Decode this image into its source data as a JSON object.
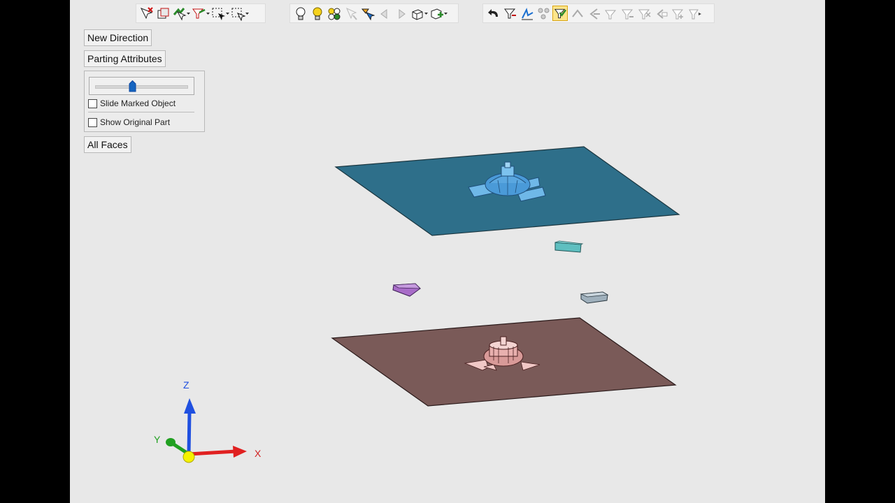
{
  "panel": {
    "new_direction": "New Direction",
    "parting_attributes": "Parting Attributes",
    "all_faces": "All Faces",
    "slider_value": 0.4,
    "slide_marked_object": {
      "label": "Slide Marked Object",
      "checked": false
    },
    "show_original_part": {
      "label": "Show Original Part",
      "checked": false
    }
  },
  "toolbar": {
    "group1": [
      "deselect-icon",
      "box-select-icon",
      "select-arrow-icon",
      "filter-select-icon",
      "add-select-icon",
      "rect-select-icon"
    ],
    "group2": [
      "bulb-off-icon",
      "bulb-on-icon",
      "show-hide-icon",
      "pointer-disabled-icon",
      "color-tool-icon",
      "arrow-left-icon",
      "arrow-right-icon",
      "view-cube-icon",
      "add-view-icon"
    ],
    "group3": [
      "undo-icon",
      "filter-icon",
      "align-icon",
      "group-icon",
      "check-filter-icon",
      "tool-1-icon",
      "tool-2-icon",
      "tool-3-icon",
      "tool-4-icon",
      "tool-5-icon",
      "tool-6-icon",
      "tool-7-icon",
      "tool-8-icon"
    ]
  },
  "axes": {
    "x": "X",
    "y": "Y",
    "z": "Z"
  },
  "colors": {
    "top_plate": "#2e6f8a",
    "bottom_plate": "#7a5a58",
    "top_core": "#4a9ad8",
    "bottom_core": "#d89a98",
    "slider_teal": "#5fbfc0",
    "slider_purple": "#a86cc8",
    "slider_gray": "#9fb0bc",
    "x_axis": "#e02020",
    "y_axis": "#20a020",
    "z_axis": "#2050e0"
  }
}
